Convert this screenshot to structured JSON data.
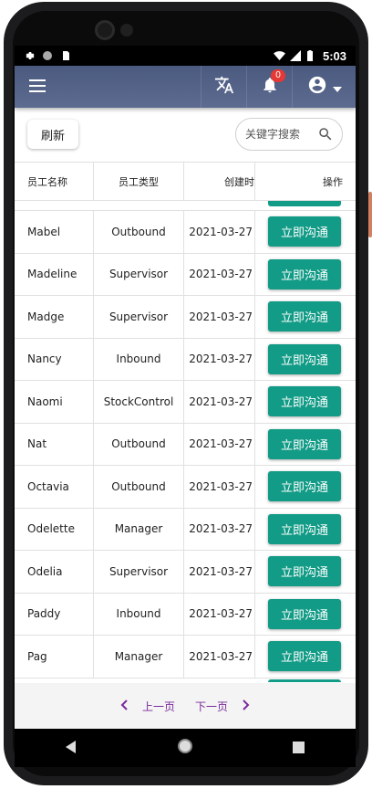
{
  "status_bar": {
    "time": "5:03"
  },
  "app_bar": {
    "notification_count": "0"
  },
  "toolbar": {
    "refresh_label": "刷新",
    "search_placeholder": "关键字搜索"
  },
  "table": {
    "headers": [
      "员工名称",
      "员工类型",
      "创建时",
      "操作"
    ],
    "action_label": "立即沟通",
    "rows": [
      {
        "name": "Mabel",
        "type": "Outbound",
        "created": "2021-03-27"
      },
      {
        "name": "Madeline",
        "type": "Supervisor",
        "created": "2021-03-27"
      },
      {
        "name": "Madge",
        "type": "Supervisor",
        "created": "2021-03-27"
      },
      {
        "name": "Nancy",
        "type": "Inbound",
        "created": "2021-03-27"
      },
      {
        "name": "Naomi",
        "type": "StockControl",
        "created": "2021-03-27"
      },
      {
        "name": "Nat",
        "type": "Outbound",
        "created": "2021-03-27"
      },
      {
        "name": "Octavia",
        "type": "Outbound",
        "created": "2021-03-27"
      },
      {
        "name": "Odelette",
        "type": "Manager",
        "created": "2021-03-27"
      },
      {
        "name": "Odelia",
        "type": "Supervisor",
        "created": "2021-03-27"
      },
      {
        "name": "Paddy",
        "type": "Inbound",
        "created": "2021-03-27"
      },
      {
        "name": "Pag",
        "type": "Manager",
        "created": "2021-03-27"
      }
    ]
  },
  "pager": {
    "prev_label": "上一页",
    "next_label": "下一页"
  }
}
